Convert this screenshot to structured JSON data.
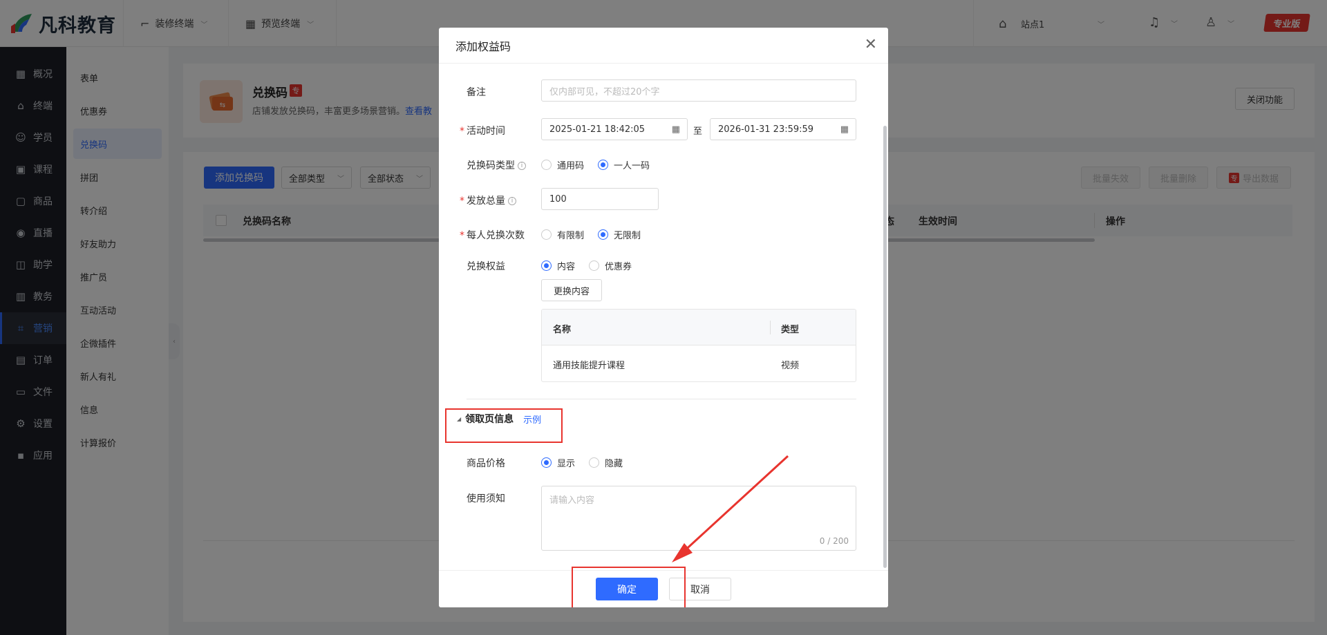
{
  "topbar": {
    "logo_text": "凡科教育",
    "menu_decorate": "装修终端",
    "menu_preview": "预览终端",
    "site_select": "站点1",
    "pro_badge": "专业版"
  },
  "leftnav": {
    "items": [
      {
        "icon": "overview-icon",
        "glyph": "▦",
        "label": "概况"
      },
      {
        "icon": "terminal-icon",
        "glyph": "⌂",
        "label": "终端"
      },
      {
        "icon": "student-icon",
        "glyph": "☺",
        "label": "学员"
      },
      {
        "icon": "course-icon",
        "glyph": "▣",
        "label": "课程"
      },
      {
        "icon": "product-icon",
        "glyph": "▢",
        "label": "商品"
      },
      {
        "icon": "live-icon",
        "glyph": "◉",
        "label": "直播"
      },
      {
        "icon": "assist-icon",
        "glyph": "◫",
        "label": "助学"
      },
      {
        "icon": "academic-icon",
        "glyph": "▥",
        "label": "教务"
      },
      {
        "icon": "marketing-icon",
        "glyph": "⌗",
        "label": "营销",
        "active": true
      },
      {
        "icon": "order-icon",
        "glyph": "▤",
        "label": "订单"
      },
      {
        "icon": "file-icon",
        "glyph": "▭",
        "label": "文件"
      },
      {
        "icon": "settings-icon",
        "glyph": "⚙",
        "label": "设置"
      },
      {
        "icon": "apps-icon",
        "glyph": "▪",
        "label": "应用"
      }
    ]
  },
  "subnav": {
    "items": [
      "表单",
      "优惠券",
      "兑换码",
      "拼团",
      "转介绍",
      "好友助力",
      "推广员",
      "互动活动",
      "企微插件",
      "新人有礼",
      "信息",
      "计算报价"
    ],
    "active_index": 2
  },
  "feature": {
    "title": "兑换码",
    "pro_mini": "专",
    "desc": "店铺发放兑换码，丰富更多场景营销。",
    "desc_link": "查看教",
    "close_btn": "关闭功能"
  },
  "list": {
    "add_btn": "添加兑换码",
    "filter_type": "全部类型",
    "filter_status": "全部状态",
    "batch_invalid": "批量失效",
    "batch_delete": "批量删除",
    "export_badge": "专",
    "export": "导出数据",
    "col_name": "兑换码名称",
    "col_status": "态",
    "col_effective": "生效时间",
    "col_action": "操作"
  },
  "modal": {
    "title": "添加权益码",
    "remark_label": "备注",
    "remark_placeholder": "仅内部可见，不超过20个字",
    "time_label": "活动时间",
    "time_start": "2025-01-21 18:42:05",
    "time_sep": "至",
    "time_end": "2026-01-31 23:59:59",
    "type_label": "兑换码类型",
    "type_opt1": "通用码",
    "type_opt2": "一人一码",
    "total_label": "发放总量",
    "total_value": "100",
    "per_label": "每人兑换次数",
    "per_opt1": "有限制",
    "per_opt2": "无限制",
    "benefit_label": "兑换权益",
    "benefit_opt1": "内容",
    "benefit_opt2": "优惠券",
    "change_btn": "更换内容",
    "table": {
      "col_name": "名称",
      "col_type": "类型",
      "rows": [
        {
          "name": "通用技能提升课程",
          "type": "视频"
        }
      ]
    },
    "section_title": "领取页信息",
    "section_link": "示例",
    "price_label": "商品价格",
    "price_opt1": "显示",
    "price_opt2": "隐藏",
    "notice_label": "使用须知",
    "notice_placeholder": "请输入内容",
    "notice_count": "0 / 200",
    "confirm": "确定",
    "cancel": "取消"
  },
  "colors": {
    "primary": "#2f6bff",
    "danger": "#e8342e",
    "nav_bg": "#1c1f26"
  }
}
